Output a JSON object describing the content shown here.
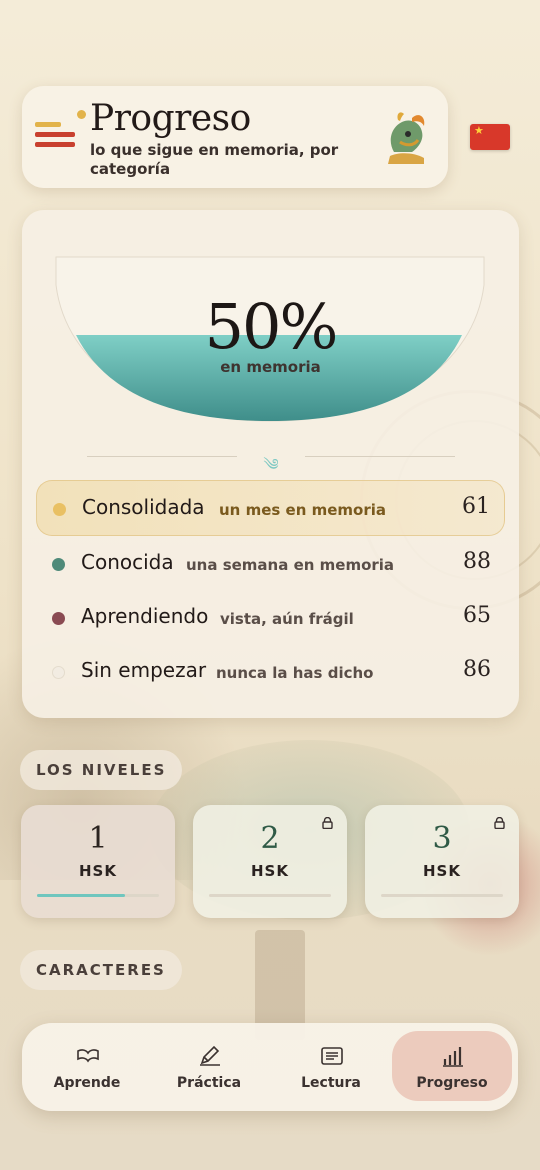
{
  "header": {
    "title": "Progreso",
    "subtitle": "lo que sigue en memoria, por categoría",
    "mascot": "dragon-mascot-icon",
    "flag": "china-flag-icon"
  },
  "summary": {
    "percent_label": "50%",
    "percent_value": 0.5,
    "caption": "en memoria"
  },
  "categories": [
    {
      "name": "Consolidada",
      "description": "un mes en memoria",
      "count": "61",
      "color": "#e9c063",
      "active": true
    },
    {
      "name": "Conocida",
      "description": "una semana en memoria",
      "count": "88",
      "color": "#4f8a79"
    },
    {
      "name": "Aprendiendo",
      "description": "vista, aún frágil",
      "count": "65",
      "color": "#8a4a52"
    },
    {
      "name": "Sin empezar",
      "description": "nunca la has dicho",
      "count": "86",
      "color": "#f2ece2"
    }
  ],
  "levels_section": {
    "label": "LOS NIVELES",
    "levels": [
      {
        "number": "1",
        "label": "HSK",
        "progress": 0.72,
        "locked": false,
        "selected": true
      },
      {
        "number": "2",
        "label": "HSK",
        "progress": 0,
        "locked": true
      },
      {
        "number": "3",
        "label": "HSK",
        "progress": 0,
        "locked": true
      }
    ]
  },
  "characters_section": {
    "label": "CARACTERES"
  },
  "nav": {
    "items": [
      {
        "label": "Aprende",
        "icon": "book-icon"
      },
      {
        "label": "Práctica",
        "icon": "pencil-icon"
      },
      {
        "label": "Lectura",
        "icon": "reading-icon"
      },
      {
        "label": "Progreso",
        "icon": "bar-chart-icon",
        "active": true
      }
    ]
  },
  "colors": {
    "accent_red": "#c8402e",
    "accent_gold": "#e2b34a",
    "teal": "#6fc6be"
  }
}
